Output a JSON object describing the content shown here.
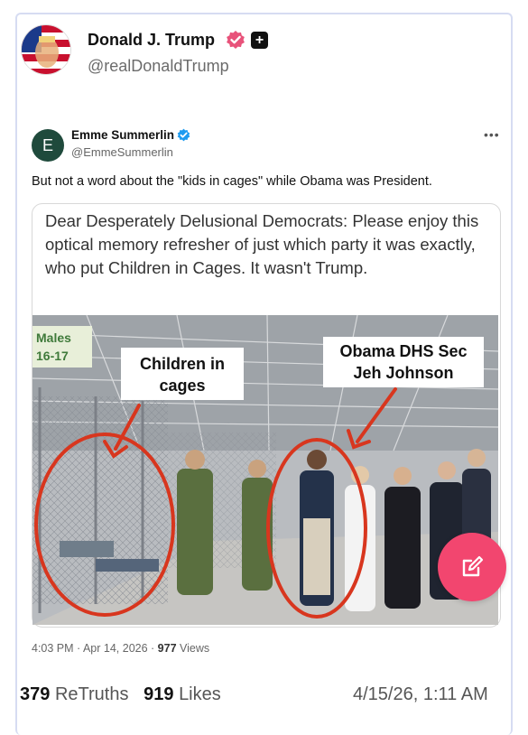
{
  "post": {
    "author_name": "Donald J. Trump",
    "author_handle": "@realDonaldTrump",
    "retruths_count": "379",
    "retruths_label": "ReTruths",
    "likes_count": "919",
    "likes_label": "Likes",
    "date": "4/15/26, 1:11 AM"
  },
  "embedded": {
    "avatar_letter": "E",
    "name": "Emme Summerlin",
    "handle": "@EmmeSummerlin",
    "text": "But not a word about the \"kids in cages\" while Obama was President.",
    "quote_text": "Dear Desperately Delusional Democrats: Please enjoy this optical memory refresher of just which party it was exactly, who put Children in Cages. It wasn't Trump.",
    "time": "4:03 PM · Apr 14, 2026 · ",
    "views_count": "977",
    "views_label": " Views"
  },
  "photo": {
    "sign_label": "Males 16-17",
    "caption_left": "Children in cages",
    "caption_right": "Obama DHS Sec Jeh Johnson"
  },
  "icons": {
    "verified": "verified-badge-icon",
    "plus": "plus-badge-icon",
    "more": "more-options-icon",
    "edit": "pencil-edit-icon"
  },
  "colors": {
    "accent": "#f2466f",
    "verified_bg": "#e8527a",
    "embedded_check": "#1d9bf0",
    "annotation": "#d8361e"
  }
}
